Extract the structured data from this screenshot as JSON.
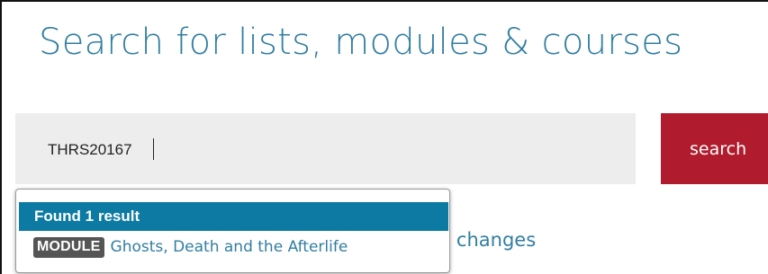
{
  "header": {
    "title": "Search for lists, modules & courses"
  },
  "search": {
    "value": "THRS20167",
    "button_label": "search"
  },
  "background": {
    "partial_text": "t changes"
  },
  "autocomplete": {
    "status": "Found 1 result",
    "results": [
      {
        "type": "MODULE",
        "title": "Ghosts, Death and the Afterlife"
      }
    ]
  },
  "colors": {
    "title": "#317ea1",
    "search_button": "#b01c2e",
    "dropdown_header": "#0d7aa3",
    "badge": "#555555",
    "search_box": "#ededed"
  }
}
